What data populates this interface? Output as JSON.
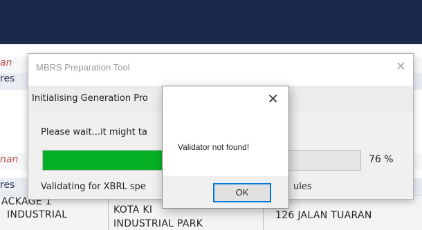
{
  "background": {
    "left_labels": [
      "an",
      "res",
      "nan",
      "res"
    ],
    "table": {
      "col1": [
        "ACKAGE 1",
        "INDUSTRIAL"
      ],
      "col2": [
        "KOTA KI",
        "INDUSTRIAL PARK"
      ],
      "col3": "126 JALAN TUARAN"
    }
  },
  "dialog": {
    "title": "MBRS Preparation Tool",
    "close_glyph": "✕",
    "subheading": "Initialising Generation Pro",
    "wait_text": "Please wait...it might ta",
    "progress_percent": 76,
    "progress_label": "76 %",
    "status_left": "Validating for XBRL spe",
    "status_right": "ules"
  },
  "alert": {
    "close_glyph": "✕",
    "message": "Validator not found!",
    "ok_label": "OK"
  },
  "colors": {
    "header": "#1b2a4a",
    "progress_fill": "#06b025",
    "focus_border": "#0078d7"
  }
}
